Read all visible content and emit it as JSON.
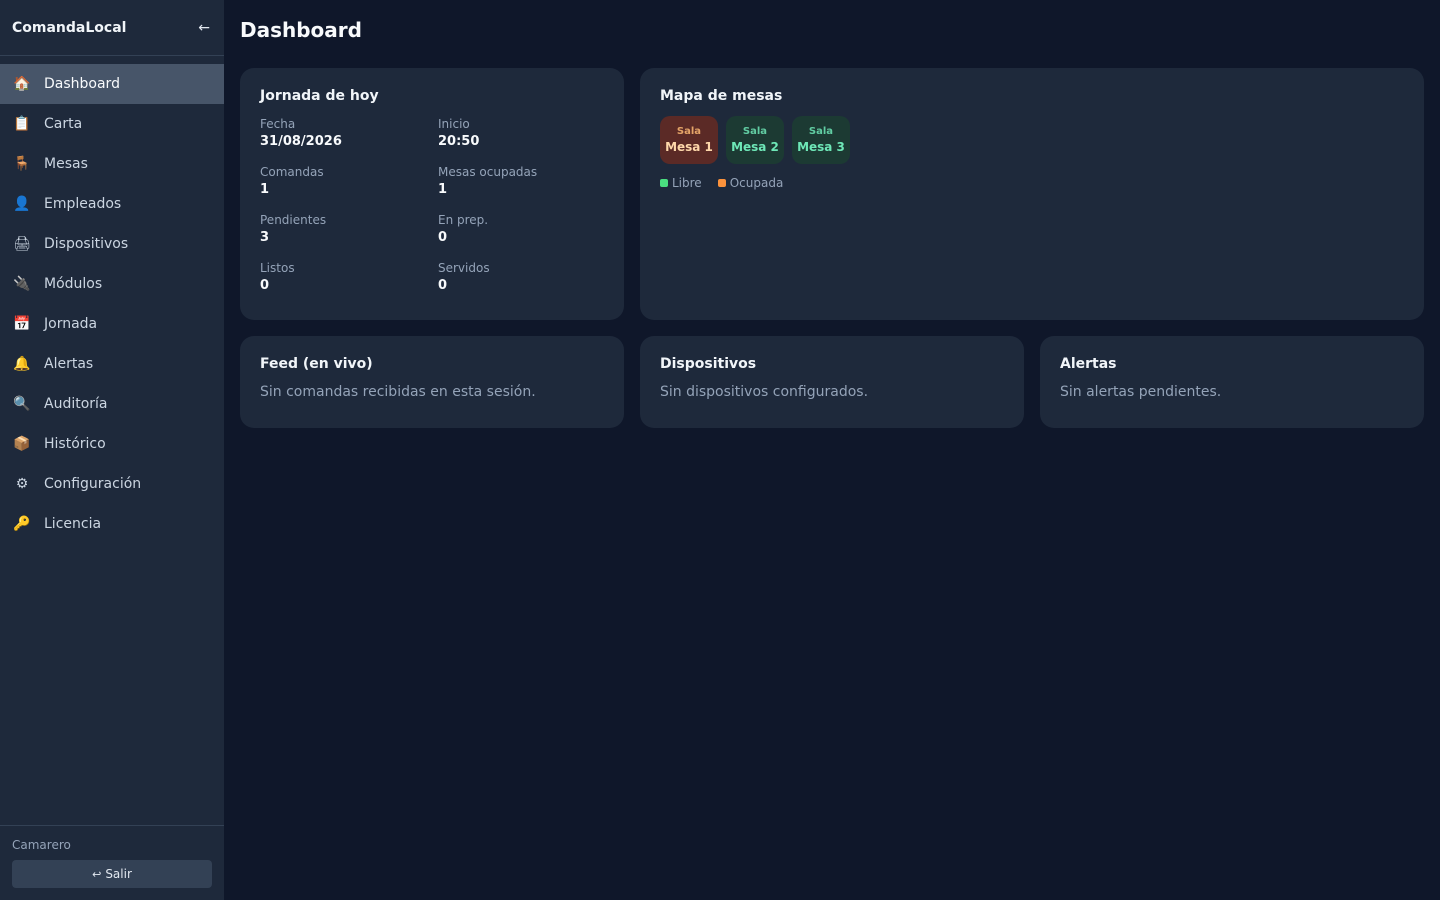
{
  "app": {
    "brand": "ComandaLocal",
    "collapse_glyph": "←"
  },
  "sidebar": {
    "items": [
      {
        "label": "Dashboard",
        "icon": "🏠",
        "icon_name": "home-icon",
        "active": true
      },
      {
        "label": "Carta",
        "icon": "📋",
        "icon_name": "clipboard-icon"
      },
      {
        "label": "Mesas",
        "icon": "🪑",
        "icon_name": "chair-icon"
      },
      {
        "label": "Empleados",
        "icon": "👤",
        "icon_name": "user-icon"
      },
      {
        "label": "Dispositivos",
        "icon": "🖨",
        "icon_name": "printer-icon"
      },
      {
        "label": "Módulos",
        "icon": "🔌",
        "icon_name": "plug-icon"
      },
      {
        "label": "Jornada",
        "icon": "📅",
        "icon_name": "calendar-icon"
      },
      {
        "label": "Alertas",
        "icon": "🔔",
        "icon_name": "bell-icon"
      },
      {
        "label": "Auditoría",
        "icon": "🔍",
        "icon_name": "magnifier-icon"
      },
      {
        "label": "Histórico",
        "icon": "📦",
        "icon_name": "package-icon"
      },
      {
        "label": "Configuración",
        "icon": "⚙",
        "icon_name": "gear-icon"
      },
      {
        "label": "Licencia",
        "icon": "🔑",
        "icon_name": "key-icon"
      }
    ],
    "footer": {
      "role": "Camarero",
      "logout_icon": "↩",
      "logout_label": "Salir"
    }
  },
  "main": {
    "title": "Dashboard",
    "jornada": {
      "title": "Jornada de hoy",
      "stats": [
        {
          "label": "Fecha",
          "value": "31/08/2026"
        },
        {
          "label": "Inicio",
          "value": "20:50"
        },
        {
          "label": "Comandas",
          "value": "1"
        },
        {
          "label": "Mesas ocupadas",
          "value": "1"
        },
        {
          "label": "Pendientes",
          "value": "3"
        },
        {
          "label": "En prep.",
          "value": "0"
        },
        {
          "label": "Listos",
          "value": "0"
        },
        {
          "label": "Servidos",
          "value": "0"
        }
      ]
    },
    "mapa": {
      "title": "Mapa de mesas",
      "tables": [
        {
          "zone": "Sala",
          "name": "Mesa 1",
          "status": "ocupada"
        },
        {
          "zone": "Sala",
          "name": "Mesa 2",
          "status": "libre"
        },
        {
          "zone": "Sala",
          "name": "Mesa 3",
          "status": "libre"
        }
      ],
      "legend": [
        {
          "label": "Libre",
          "color": "#4ade80"
        },
        {
          "label": "Ocupada",
          "color": "#fb923c"
        }
      ]
    },
    "feed": {
      "title": "Feed (en vivo)",
      "empty": "Sin comandas recibidas en esta sesión."
    },
    "dispositivos": {
      "title": "Dispositivos",
      "empty": "Sin dispositivos configurados."
    },
    "alertas": {
      "title": "Alertas",
      "empty": "Sin alertas pendientes."
    }
  }
}
